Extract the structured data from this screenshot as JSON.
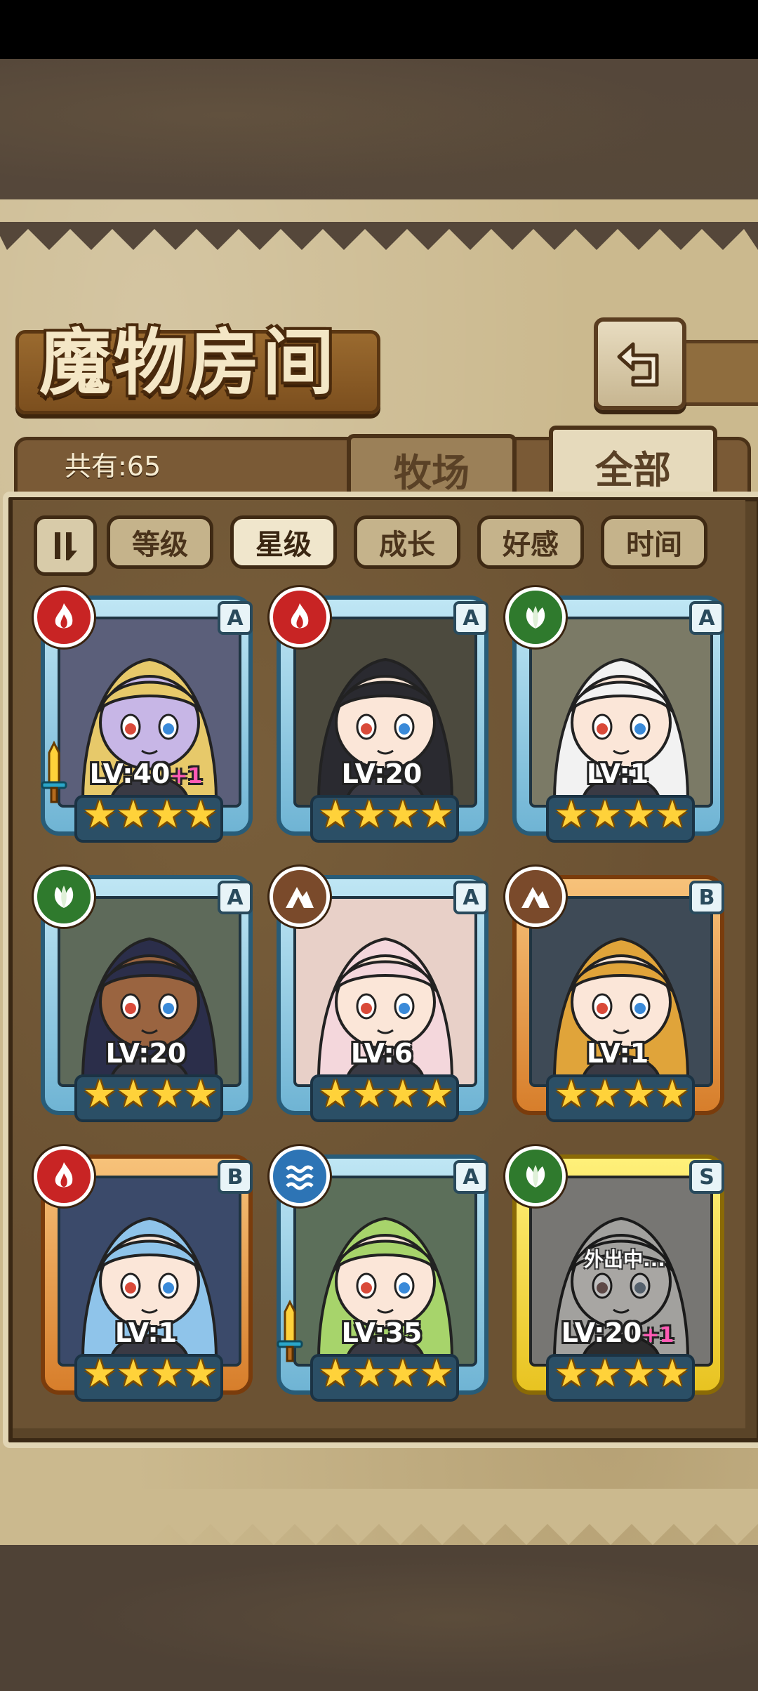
{
  "header": {
    "title": "魔物房间",
    "back_icon": "back-arrow-icon"
  },
  "tabs": {
    "count_label": "共有:65",
    "ranch": "牧场",
    "all": "全部",
    "active": "全部"
  },
  "sort": {
    "toggle_icon": "sort-toggle-icon",
    "buttons": [
      "等级",
      "星级",
      "成长",
      "好感",
      "时间"
    ],
    "active": "星级"
  },
  "colors": {
    "fire": "#c82424",
    "grass": "#2f7a2d",
    "earth": "#7a4a2b",
    "water": "#2d74b5",
    "level_bonus": "#ff5ab4",
    "star": "#ffd23a"
  },
  "monsters": [
    {
      "element": "fire",
      "element_icon": "fire-element-icon",
      "rank": "A",
      "level": "LV:40",
      "bonus": "+1",
      "stars": 4,
      "weapon": true,
      "status": ""
    },
    {
      "element": "fire",
      "element_icon": "fire-element-icon",
      "rank": "A",
      "level": "LV:20",
      "bonus": "",
      "stars": 4,
      "weapon": false,
      "status": ""
    },
    {
      "element": "grass",
      "element_icon": "grass-element-icon",
      "rank": "A",
      "level": "LV:1",
      "bonus": "",
      "stars": 4,
      "weapon": false,
      "status": ""
    },
    {
      "element": "grass",
      "element_icon": "grass-element-icon",
      "rank": "A",
      "level": "LV:20",
      "bonus": "",
      "stars": 4,
      "weapon": false,
      "status": ""
    },
    {
      "element": "earth",
      "element_icon": "earth-element-icon",
      "rank": "A",
      "level": "LV:6",
      "bonus": "",
      "stars": 4,
      "weapon": false,
      "status": ""
    },
    {
      "element": "earth",
      "element_icon": "earth-element-icon",
      "rank": "B",
      "level": "LV:1",
      "bonus": "",
      "stars": 4,
      "weapon": false,
      "status": ""
    },
    {
      "element": "fire",
      "element_icon": "fire-element-icon",
      "rank": "B",
      "level": "LV:1",
      "bonus": "",
      "stars": 4,
      "weapon": false,
      "status": ""
    },
    {
      "element": "water",
      "element_icon": "water-element-icon",
      "rank": "A",
      "level": "LV:35",
      "bonus": "",
      "stars": 4,
      "weapon": true,
      "status": ""
    },
    {
      "element": "grass",
      "element_icon": "grass-element-icon",
      "rank": "S",
      "level": "LV:20",
      "bonus": "+1",
      "stars": 4,
      "weapon": false,
      "status": "外出中..."
    }
  ]
}
